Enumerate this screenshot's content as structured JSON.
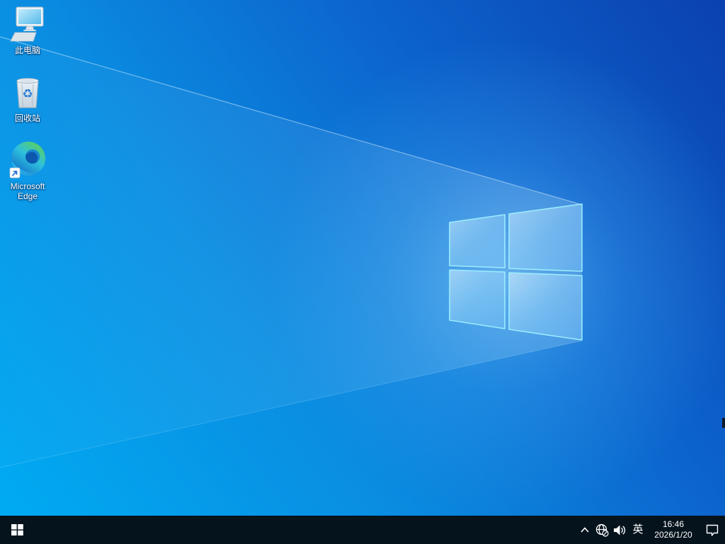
{
  "wallpaper": {
    "name": "windows-10-light-rays",
    "colors": {
      "bright_cyan": "#00abf3",
      "sky_blue": "#1a9ae4",
      "deep_blue": "#0b41b0",
      "mid_blue": "#1252c2",
      "logo_edge_glow": "#9defff"
    }
  },
  "desktop": {
    "icons": [
      {
        "name": "this-pc",
        "label": "此电脑"
      },
      {
        "name": "recycle-bin",
        "label": "回收站"
      },
      {
        "name": "microsoft-edge",
        "label": "Microsoft Edge"
      }
    ]
  },
  "taskbar": {
    "background_color": "#05131d",
    "icon_names": [
      "windows-start-icon",
      "hidden-icons-chevron-icon",
      "network-globe-offline-icon",
      "speaker-volume-icon",
      "action-center-bubble-icon"
    ],
    "ime_indicator": "英",
    "clock": {
      "time": "16:46",
      "date": "2026/1/20"
    }
  }
}
